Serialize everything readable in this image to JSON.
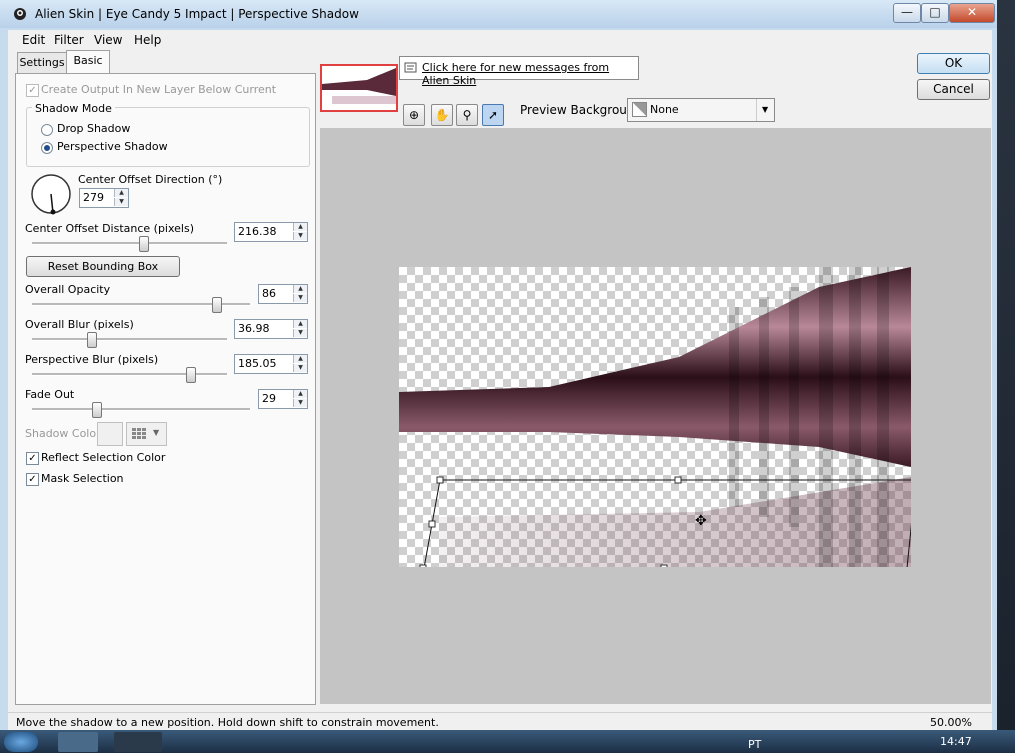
{
  "window": {
    "title": "Alien Skin | Eye Candy 5 Impact | Perspective Shadow",
    "minimize": "—",
    "maximize": "□",
    "close": "✕"
  },
  "menu": [
    "Edit",
    "Filter",
    "View",
    "Help"
  ],
  "tabs": {
    "settings": "Settings",
    "basic": "Basic"
  },
  "panel": {
    "create_output": "Create Output In New Layer Below Current",
    "shadow_mode": {
      "title": "Shadow Mode",
      "drop": "Drop Shadow",
      "perspective": "Perspective Shadow",
      "selected": "Perspective Shadow"
    },
    "center_offset_direction": {
      "label": "Center Offset Direction (°)",
      "value": "279"
    },
    "center_offset_distance": {
      "label": "Center Offset Distance (pixels)",
      "value": "216.38",
      "slider": 0.57
    },
    "reset_button": "Reset Bounding Box",
    "overall_opacity": {
      "label": "Overall Opacity",
      "value": "86",
      "slider": 0.85
    },
    "overall_blur": {
      "label": "Overall Blur (pixels)",
      "value": "36.98",
      "slider": 0.28
    },
    "perspective_blur": {
      "label": "Perspective Blur (pixels)",
      "value": "185.05",
      "slider": 0.73
    },
    "fade_out": {
      "label": "Fade Out",
      "value": "29",
      "slider": 0.29
    },
    "shadow_color": {
      "label": "Shadow Color"
    },
    "reflect_selection_color": {
      "label": "Reflect Selection Color",
      "checked": true
    },
    "mask_selection": {
      "label": "Mask Selection",
      "checked": true
    }
  },
  "messages_link": "Click here for new messages from Alien Skin",
  "preview_background": {
    "label": "Preview Background:",
    "value": "None"
  },
  "buttons": {
    "ok": "OK",
    "cancel": "Cancel"
  },
  "status": {
    "message": "Move the shadow to a new position. Hold down shift to constrain movement.",
    "zoom": "50.00%"
  },
  "taskbar": {
    "lang": "PT",
    "time": "14:47"
  },
  "colors": {
    "accent": "#3c7fb1",
    "shadow": "#7a4a5c"
  }
}
